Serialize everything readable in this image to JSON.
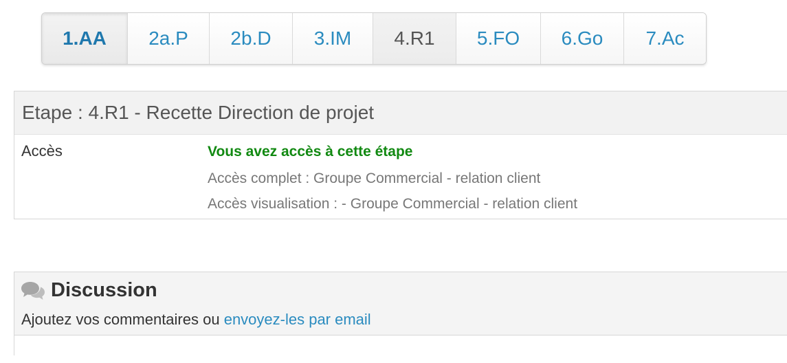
{
  "tabs": [
    {
      "label": "1.AA",
      "state": "pressed"
    },
    {
      "label": "2a.P",
      "state": "normal"
    },
    {
      "label": "2b.D",
      "state": "normal"
    },
    {
      "label": "3.IM",
      "state": "normal"
    },
    {
      "label": "4.R1",
      "state": "current"
    },
    {
      "label": "5.FO",
      "state": "normal"
    },
    {
      "label": "6.Go",
      "state": "normal"
    },
    {
      "label": "7.Ac",
      "state": "normal"
    }
  ],
  "etape": {
    "title": "Etape : 4.R1 - Recette Direction de projet",
    "access_label": "Accès",
    "access_status": "Vous avez accès à cette étape",
    "access_full": "Accès complet : Groupe Commercial - relation client",
    "access_view": "Accès visualisation : - Groupe Commercial - relation client"
  },
  "discussion": {
    "icon": "chat-bubbles-icon",
    "title": "Discussion",
    "subtitle_prefix": "Ajoutez vos commentaires ou ",
    "email_link": "envoyez-les par email"
  },
  "colors": {
    "link": "#2a8bbf",
    "success": "#118911",
    "muted": "#777777",
    "panel_bg": "#f2f2f2"
  }
}
